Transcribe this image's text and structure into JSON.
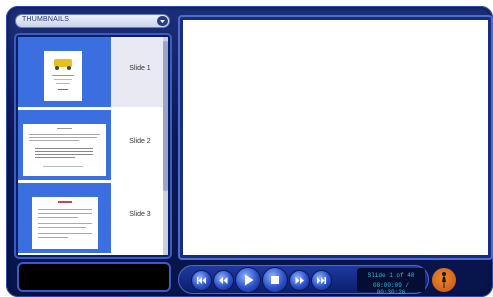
{
  "colors": {
    "frame": "#0b1a55",
    "accent": "#3c5bc4",
    "thumb_bg": "#3b6fe0",
    "status_text": "#27c6d6",
    "logo": "#e0742a"
  },
  "thumbnails_dropdown": {
    "selected": "THUMBNAILS",
    "icon": "chevron-down-icon"
  },
  "thumbnails": [
    {
      "label": "Slide 1",
      "selected": true
    },
    {
      "label": "Slide 2",
      "selected": false
    },
    {
      "label": "Slide 3",
      "selected": false
    }
  ],
  "status": {
    "slide_counter": "Slide 1 of 40",
    "time": "00:00:09 / 00:30:26"
  },
  "controls": {
    "icons": [
      "first-slide-icon",
      "previous-slide-icon",
      "play-icon",
      "stop-icon",
      "next-slide-icon",
      "last-slide-icon"
    ]
  }
}
